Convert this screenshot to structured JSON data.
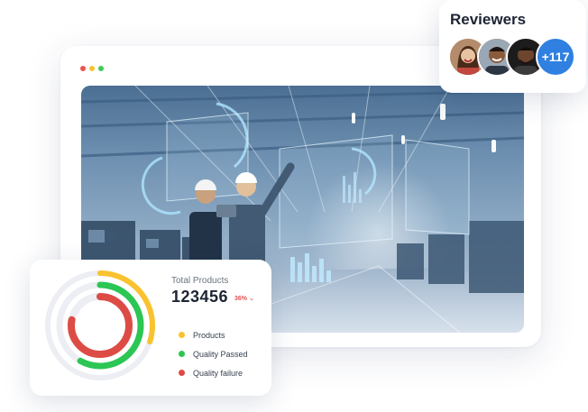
{
  "window": {
    "dot_colors": [
      "#ef5350",
      "#f9c22e",
      "#3dcc5c"
    ]
  },
  "reviewers": {
    "title": "Reviewers",
    "extra_count": "+117",
    "badge_color": "#2f80e0"
  },
  "stats": {
    "total_label": "Total Products",
    "total_value": "123456",
    "change": "36%",
    "legend": [
      {
        "label": "Products",
        "color": "#f9c22e",
        "fraction": 0.3
      },
      {
        "label": "Quality Passed",
        "color": "#2bc653",
        "fraction": 0.58
      },
      {
        "label": "Quality failure",
        "color": "#dd4b45",
        "fraction": 0.78
      }
    ]
  }
}
